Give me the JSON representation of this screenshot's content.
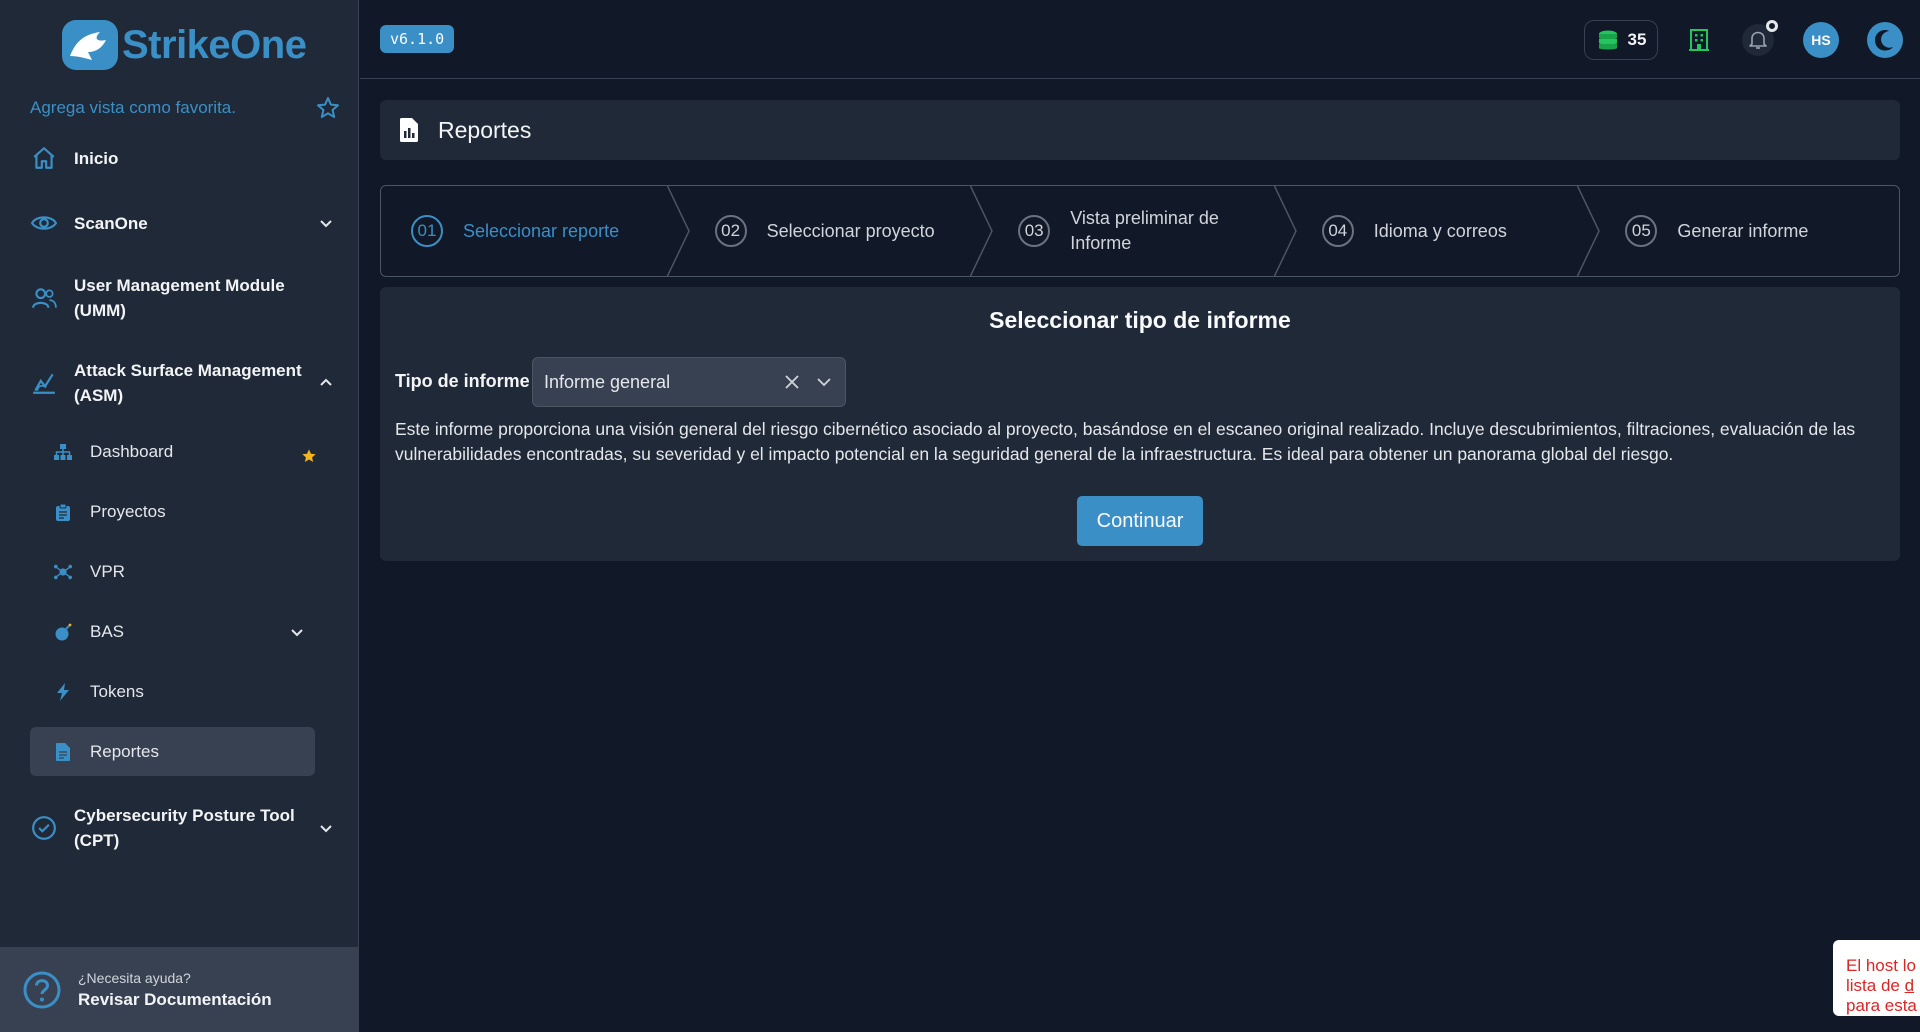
{
  "app": {
    "logo_text": "StrikeOne",
    "version": "v6.1.0",
    "brand_color": "#3b8fc7",
    "background_color": "#111827",
    "panel_color": "#1f2937"
  },
  "sidebar": {
    "favorite_text": "Agrega vista como favorita.",
    "items": [
      {
        "label": "Inicio",
        "icon": "home-icon"
      },
      {
        "label": "ScanOne",
        "icon": "eye-icon"
      },
      {
        "label": "User Management Module (UMM)",
        "icon": "users-icon"
      },
      {
        "label": "Attack Surface Management (ASM)",
        "icon": "radar-icon"
      },
      {
        "label": "Cybersecurity Posture Tool (CPT)",
        "icon": "check-circle-icon"
      }
    ],
    "sub_items": [
      {
        "label": "Dashboard",
        "icon": "hierarchy-icon",
        "favorite": true
      },
      {
        "label": "Proyectos",
        "icon": "clipboard-icon"
      },
      {
        "label": "VPR",
        "icon": "virus-icon"
      },
      {
        "label": "BAS",
        "icon": "bomb-icon"
      },
      {
        "label": "Tokens",
        "icon": "bolt-icon"
      },
      {
        "label": "Reportes",
        "icon": "file-icon",
        "active": true
      }
    ],
    "help": {
      "small": "¿Necesita ayuda?",
      "big": "Revisar Documentación"
    }
  },
  "topbar": {
    "coins": "35",
    "avatar_initials": "HS"
  },
  "page": {
    "title": "Reportes",
    "steps": [
      {
        "num": "01",
        "label": "Seleccionar reporte",
        "active": true
      },
      {
        "num": "02",
        "label": "Seleccionar proyecto"
      },
      {
        "num": "03",
        "label": "Vista preliminar de Informe"
      },
      {
        "num": "04",
        "label": "Idioma y correos"
      },
      {
        "num": "05",
        "label": "Generar informe"
      }
    ],
    "card": {
      "title": "Seleccionar tipo de informe",
      "field_label": "Tipo de informe",
      "selected_value": "Informe general",
      "description": "Este informe proporciona una visión general del riesgo cibernético asociado al proyecto, basándose en el escaneo original realizado. Incluye descubrimientos, filtraciones, evaluación de las vulnerabilidades encontradas, su severidad y el impacto potencial en la seguridad general de la infraestructura. Es ideal para obtener un panorama global del riesgo.",
      "continue_label": "Continuar"
    }
  },
  "toast": {
    "line1": "El host lo",
    "line2_a": "lista de ",
    "line2_b": "d",
    "line3": "para esta"
  }
}
